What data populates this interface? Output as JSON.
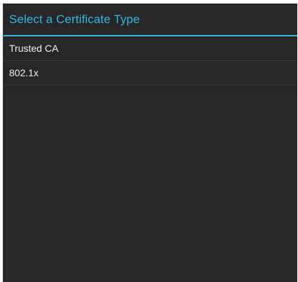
{
  "dialog": {
    "title": "Select a Certificate Type",
    "items": [
      {
        "label": "Trusted CA"
      },
      {
        "label": "802.1x"
      }
    ]
  },
  "colors": {
    "accent": "#33b5e5",
    "background": "#272727",
    "item_text": "#f2f2f2",
    "divider": "#3c3c3c"
  }
}
